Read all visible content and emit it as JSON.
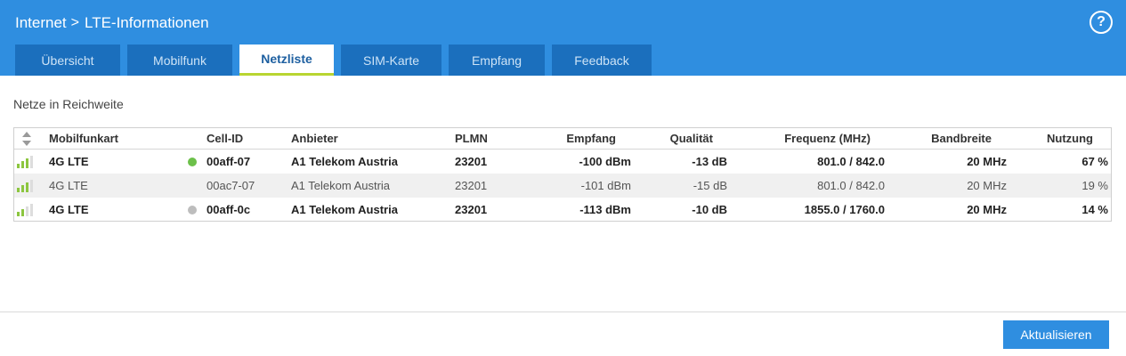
{
  "header": {
    "crumbs": [
      "Internet",
      "LTE-Informationen"
    ],
    "separator": ">",
    "help_label": "?"
  },
  "tabs": [
    {
      "label": "Übersicht",
      "active": false
    },
    {
      "label": "Mobilfunk",
      "active": false
    },
    {
      "label": "Netzliste",
      "active": true
    },
    {
      "label": "SIM-Karte",
      "active": false
    },
    {
      "label": "Empfang",
      "active": false
    },
    {
      "label": "Feedback",
      "active": false
    }
  ],
  "section": {
    "title": "Netze in Reichweite"
  },
  "table": {
    "columns": [
      "Mobilfunkart",
      "Cell-ID",
      "Anbieter",
      "PLMN",
      "Empfang",
      "Qualität",
      "Frequenz (MHz)",
      "Bandbreite",
      "Nutzung"
    ],
    "rows": [
      {
        "signal_bars": 3,
        "type": "4G LTE",
        "status": "active",
        "cell_id": "00aff-07",
        "provider": "A1 Telekom Austria",
        "plmn": "23201",
        "empfang": "-100 dBm",
        "qualitaet": "-13 dB",
        "frequenz": "801.0 / 842.0",
        "bandbreite": "20 MHz",
        "nutzung": "67 %"
      },
      {
        "signal_bars": 3,
        "type": "4G LTE",
        "status": "none",
        "cell_id": "00ac7-07",
        "provider": "A1 Telekom Austria",
        "plmn": "23201",
        "empfang": "-101 dBm",
        "qualitaet": "-15 dB",
        "frequenz": "801.0 / 842.0",
        "bandbreite": "20 MHz",
        "nutzung": "19 %"
      },
      {
        "signal_bars": 2,
        "type": "4G LTE",
        "status": "inactive",
        "cell_id": "00aff-0c",
        "provider": "A1 Telekom Austria",
        "plmn": "23201",
        "empfang": "-113 dBm",
        "qualitaet": "-10 dB",
        "frequenz": "1855.0 / 1760.0",
        "bandbreite": "20 MHz",
        "nutzung": "14 %"
      }
    ],
    "icons": {
      "sort": "sort-icon",
      "signal": "signal-bars-icon"
    }
  },
  "footer": {
    "refresh_label": "Aktualisieren"
  },
  "colors": {
    "header_bg": "#2f8ee0",
    "tab_bg": "#1b6fbd",
    "tab_active_underline": "#b8d531",
    "signal_on": "#8cc63f",
    "signal_off": "#dddddd",
    "status_active": "#6cc04a",
    "status_inactive": "#bdbdbd",
    "button_bg": "#2f8ee0"
  }
}
